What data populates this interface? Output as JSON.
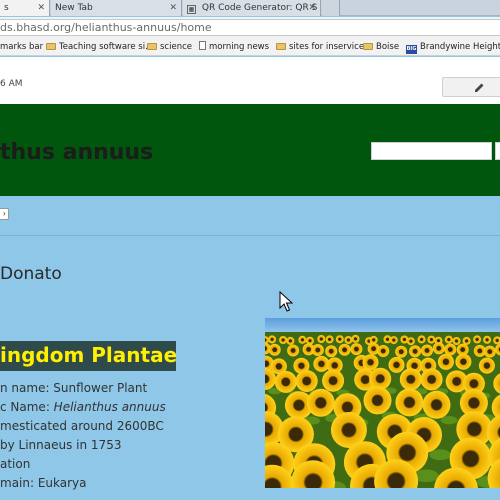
{
  "browser": {
    "tabs": [
      {
        "label": "s",
        "active": true
      },
      {
        "label": "New Tab",
        "active": false
      },
      {
        "label": "QR Code Generator: QR S",
        "active": false
      }
    ],
    "url": "ds.bhasd.org/helianthus-annuus/home",
    "bookmarks": [
      {
        "label": "marks bar",
        "icon": "none"
      },
      {
        "label": "Teaching software si...",
        "icon": "folder-icon"
      },
      {
        "label": "science",
        "icon": "folder-icon"
      },
      {
        "label": "morning news",
        "icon": "doc-icon"
      },
      {
        "label": "sites for inservice",
        "icon": "folder-icon"
      },
      {
        "label": "Boise",
        "icon": "folder-icon"
      },
      {
        "label": "Brandywine Heights...",
        "icon": "big-icon"
      }
    ]
  },
  "page": {
    "time": "6 AM",
    "site_title": "thus annuus",
    "author": "Donato",
    "kingdom_heading": "ingdom Plantae",
    "facts": [
      {
        "prefix": "n name: Sunflower Plant",
        "italic": ""
      },
      {
        "prefix": "c Name: ",
        "italic": "Helianthus annuus"
      },
      {
        "prefix": "mesticated around 2600BC",
        "italic": ""
      },
      {
        "prefix": "by Linnaeus in 1753",
        "italic": ""
      },
      {
        "prefix": "ation",
        "italic": ""
      },
      {
        "prefix": "main: Eukarya",
        "italic": ""
      }
    ],
    "colors": {
      "header": "#00560c",
      "page_bg": "#8ec7e8",
      "kingdom_bg": "#2f4a4a",
      "kingdom_text": "#ffef00"
    }
  }
}
